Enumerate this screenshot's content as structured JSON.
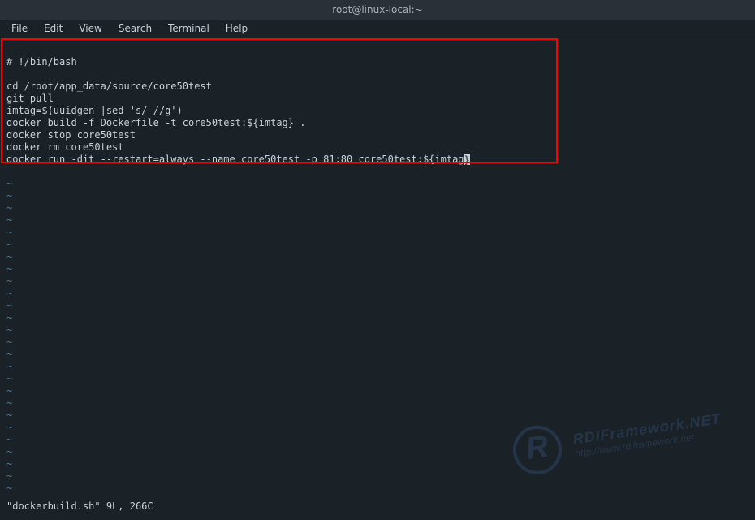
{
  "titlebar": {
    "title": "root@linux-local:~"
  },
  "menubar": {
    "items": [
      {
        "label": "File",
        "key": "F"
      },
      {
        "label": "Edit",
        "key": "E"
      },
      {
        "label": "View",
        "key": "V"
      },
      {
        "label": "Search",
        "key": "S"
      },
      {
        "label": "Terminal",
        "key": "T"
      },
      {
        "label": "Help",
        "key": "H"
      }
    ]
  },
  "script": {
    "lines": [
      "# !/bin/bash",
      "",
      "cd /root/app_data/source/core50test",
      "git pull",
      "imtag=$(uuidgen |sed 's/-//g')",
      "docker build -f Dockerfile -t core50test:${imtag} .",
      "docker stop core50test",
      "docker rm core50test",
      "docker run -dit --restart=always --name core50test -p 81:80 core50test:${imtag"
    ],
    "cursor_char": "}"
  },
  "tilde_count": 26,
  "status": "\"dockerbuild.sh\" 9L, 266C",
  "watermark": {
    "title": "RDIFramework.NET",
    "url": "http://www.rdiframework.net"
  }
}
